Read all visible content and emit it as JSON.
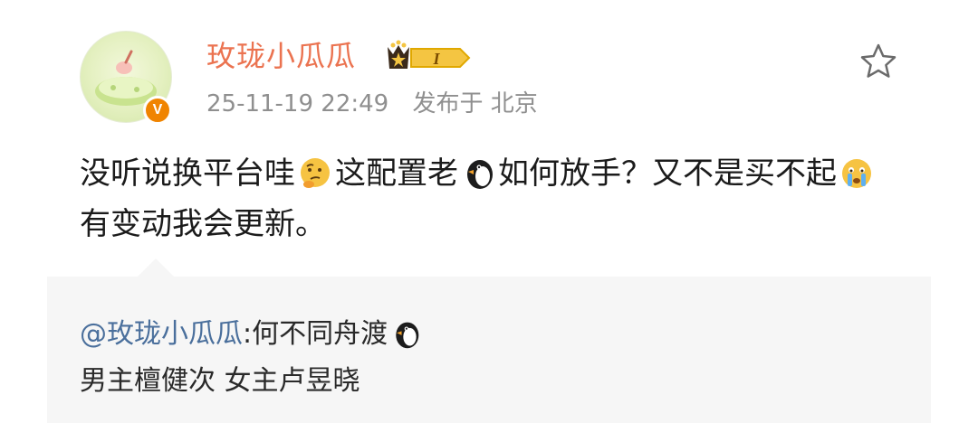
{
  "post": {
    "author": "玫珑小瓜瓜",
    "level": "I",
    "date": "25-11-19 22:49",
    "location_prefix": "发布于",
    "location": "北京",
    "content_parts": [
      "没听说换平台哇",
      "这配置老",
      "如何放手？又不是买不起",
      "有变动我会更新。"
    ],
    "emojis": [
      "thinking-face-icon",
      "penguin-icon",
      "crying-face-icon"
    ]
  },
  "quote": {
    "mention": "@玫珑小瓜瓜",
    "text": ":何不同舟渡",
    "line2": "男主檀健次 女主卢昱晓"
  },
  "colors": {
    "username": "#eb7350",
    "mention": "#4a6f9c",
    "badge": "#f08400"
  }
}
